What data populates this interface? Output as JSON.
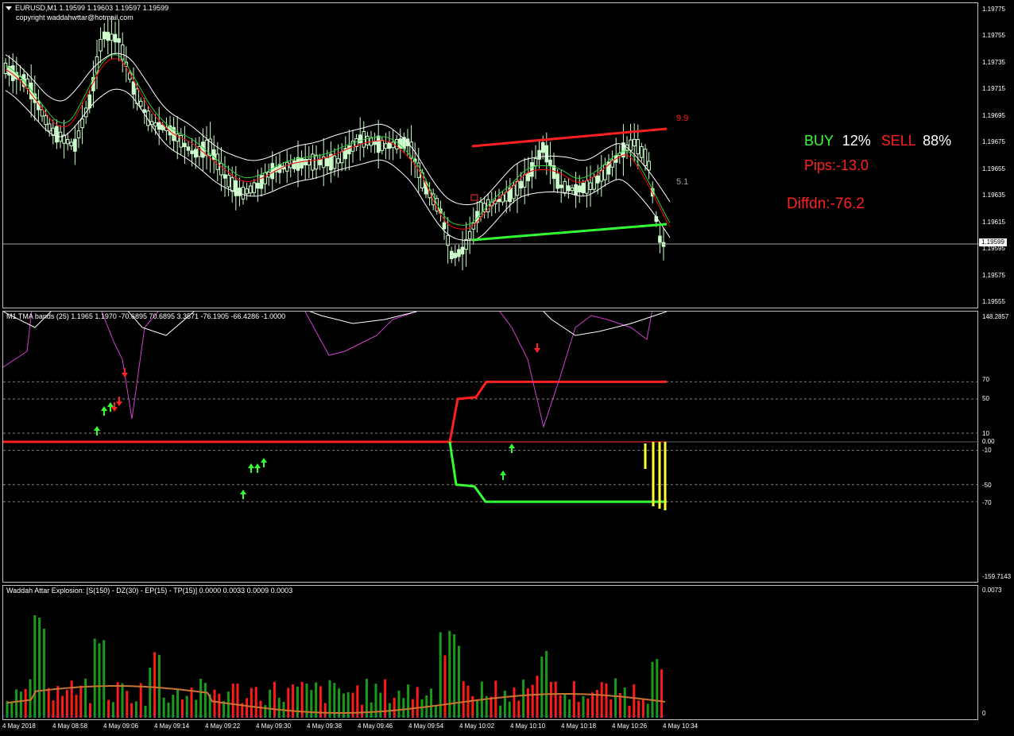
{
  "main_chart": {
    "symbol_line": "EURUSD,M1  1.19599 1.19603 1.19597 1.19599",
    "copyright": "copyright waddahwttar@hotmail.com",
    "current_price": "1.19599",
    "y_ticks": [
      "1.19775",
      "1.19755",
      "1.19735",
      "1.19715",
      "1.19695",
      "1.19675",
      "1.19655",
      "1.19635",
      "1.19615",
      "1.19595",
      "1.19575",
      "1.19555"
    ],
    "channel_upper_label": "9.9",
    "channel_mid_label": "5.1",
    "signal": {
      "buy_label": "BUY",
      "buy_pct": "12%",
      "sell_label": "SELL",
      "sell_pct": "88%",
      "pips": "Pips:-13.0",
      "diffdn": "Diffdn:-76.2"
    },
    "colors": {
      "bull_candle": "#ccffcc",
      "upper_channel": "#ff2020",
      "lower_channel": "#33ff33",
      "ema_red": "#ff0000",
      "ema_green": "#33cc33",
      "bands": "#ffffff"
    }
  },
  "tma_chart": {
    "title": "M1 TMA bands (25) 1.1965 1.1970 -70.6895 70.6895 3.3571 -76.1905 -66.4286 -1.0000",
    "y_ticks": [
      "148.2857",
      "70",
      "50",
      "10",
      "0.00",
      "-10",
      "-50",
      "-70",
      "-159.7143"
    ],
    "colors": {
      "oscillator": "#d040d0",
      "signal": "#ffffff",
      "upper": "#ff2020",
      "lower": "#33ff33",
      "histogram": "#ffff33"
    }
  },
  "waddah_chart": {
    "title": "Waddah Attar Explosion: [S(150) - DZ(30) - EP(15) - TP(15)] 0.0000 0.0033 0.0009 0.0003",
    "y_ticks": [
      "0.0073",
      "0"
    ],
    "colors": {
      "up": "#1a9a1a",
      "down": "#ff1a1a",
      "explosion_line": "#c87533"
    }
  },
  "time_axis": [
    "4 May 2018",
    "4 May 08:58",
    "4 May 09:06",
    "4 May 09:14",
    "4 May 09:22",
    "4 May 09:30",
    "4 May 09:38",
    "4 May 09:46",
    "4 May 09:54",
    "4 May 10:02",
    "4 May 10:10",
    "4 May 10:18",
    "4 May 10:26",
    "4 May 10:34"
  ]
}
